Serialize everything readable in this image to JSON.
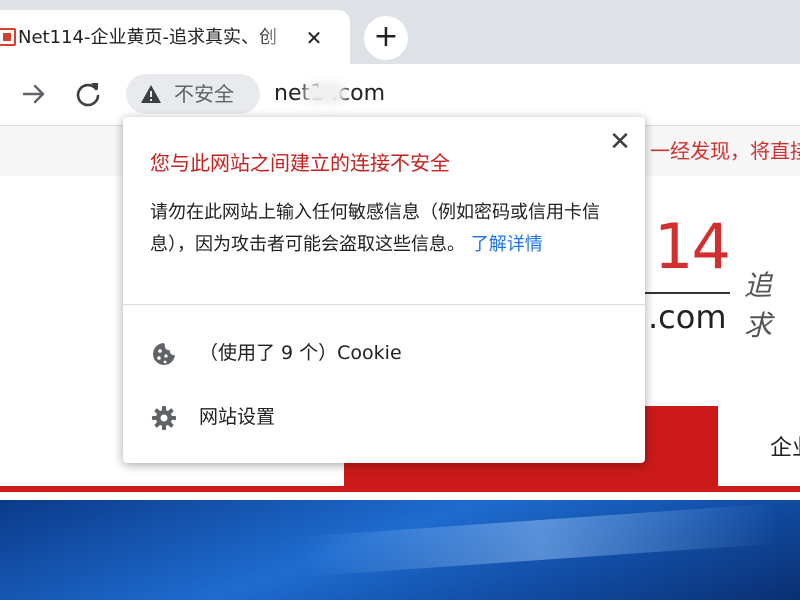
{
  "tab": {
    "title": "Net114-企业黄页-追求真实、创",
    "close_glyph": "✕",
    "favicon_name": "net114-favicon"
  },
  "newtab": {
    "glyph": "+"
  },
  "toolbar": {
    "forward_icon": "arrow-right-icon",
    "reload_icon": "reload-icon",
    "security_chip": {
      "icon": "warning-triangle-icon",
      "label": "不安全"
    },
    "url": "net1 .com"
  },
  "page": {
    "notice": "一经发现，将直接",
    "logo_number": "14",
    "logo_domain": ".com",
    "slogan": "追 求",
    "menu_item": "企业"
  },
  "popup": {
    "close_glyph": "✕",
    "title": "您与此网站之间建立的连接不安全",
    "body": "请勿在此网站上输入任何敏感信息（例如密码或信用卡信息），因为攻击者可能会盗取这些信息。",
    "learn_more": "了解详情",
    "cookie_label": "（使用了 9 个）Cookie",
    "settings_label": "网站设置",
    "cookie_icon": "cookie-icon",
    "settings_icon": "gear-icon"
  },
  "colors": {
    "title_red": "#c5221f",
    "link_blue": "#1a73e8",
    "brand_red": "#cc1a1a"
  }
}
